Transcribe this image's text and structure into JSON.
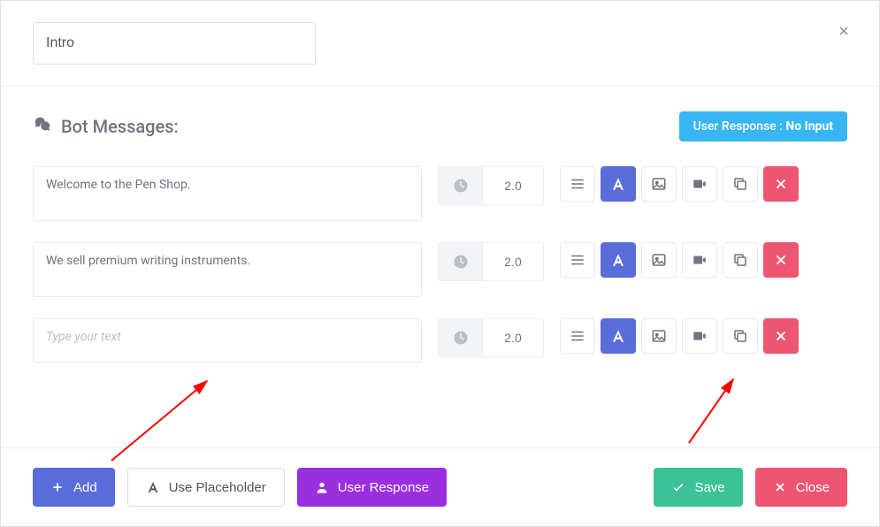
{
  "header": {
    "title_value": "Intro"
  },
  "section": {
    "title": "Bot Messages:",
    "response_badge_prefix": "User Response : ",
    "response_badge_value": "No Input"
  },
  "messages": [
    {
      "text": "Welcome to the Pen Shop.",
      "delay": "2.0"
    },
    {
      "text": "We sell premium writing instruments.",
      "delay": "2.0"
    },
    {
      "text": "",
      "placeholder": "Type your text",
      "delay": "2.0"
    }
  ],
  "footer": {
    "add": "Add",
    "use_placeholder": "Use Placeholder",
    "user_response": "User Response",
    "save": "Save",
    "close": "Close"
  }
}
